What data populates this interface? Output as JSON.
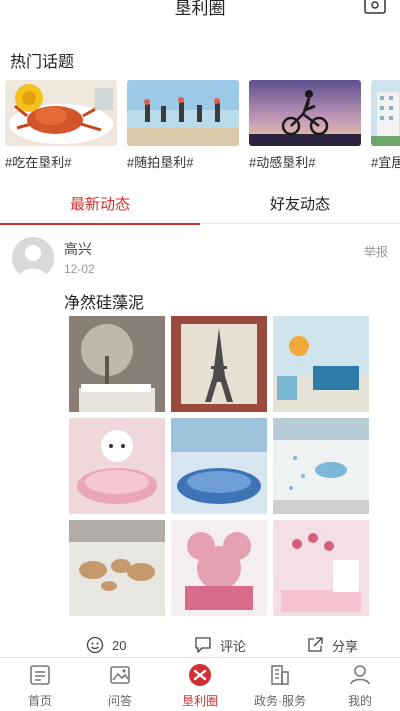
{
  "header": {
    "title": "垦利圈",
    "message_icon": "message-icon"
  },
  "hot_topics": {
    "title": "热门话题",
    "items": [
      {
        "label": "#吃在垦利#",
        "icon": "crab-food-image"
      },
      {
        "label": "#随拍垦利#",
        "icon": "beach-people-image"
      },
      {
        "label": "#动感垦利#",
        "icon": "cyclist-sunset-image"
      },
      {
        "label": "#宜居",
        "icon": "building-image"
      }
    ]
  },
  "tabs": {
    "active": "最新动态",
    "inactive": "好友动态"
  },
  "post": {
    "username": "高兴",
    "date": "12-02",
    "report": "举报",
    "text": "净然硅藻泥",
    "images": [
      "tree-mural-room",
      "eiffel-tower-wall",
      "kids-room",
      "hello-kitty-bedroom",
      "blue-round-bed",
      "whale-wall",
      "world-map-wall",
      "mickey-bedroom",
      "pink-kids-room"
    ],
    "actions": {
      "likes": "20",
      "comment": "评论",
      "share": "分享"
    }
  },
  "bottom_nav": [
    {
      "label": "首页",
      "icon": "home-icon"
    },
    {
      "label": "问答",
      "icon": "qa-icon"
    },
    {
      "label": "垦利圈",
      "icon": "circle-icon"
    },
    {
      "label": "政务·服务",
      "icon": "gov-building-icon"
    },
    {
      "label": "我的",
      "icon": "profile-icon"
    }
  ],
  "colors": {
    "accent": "#d32f2f"
  }
}
